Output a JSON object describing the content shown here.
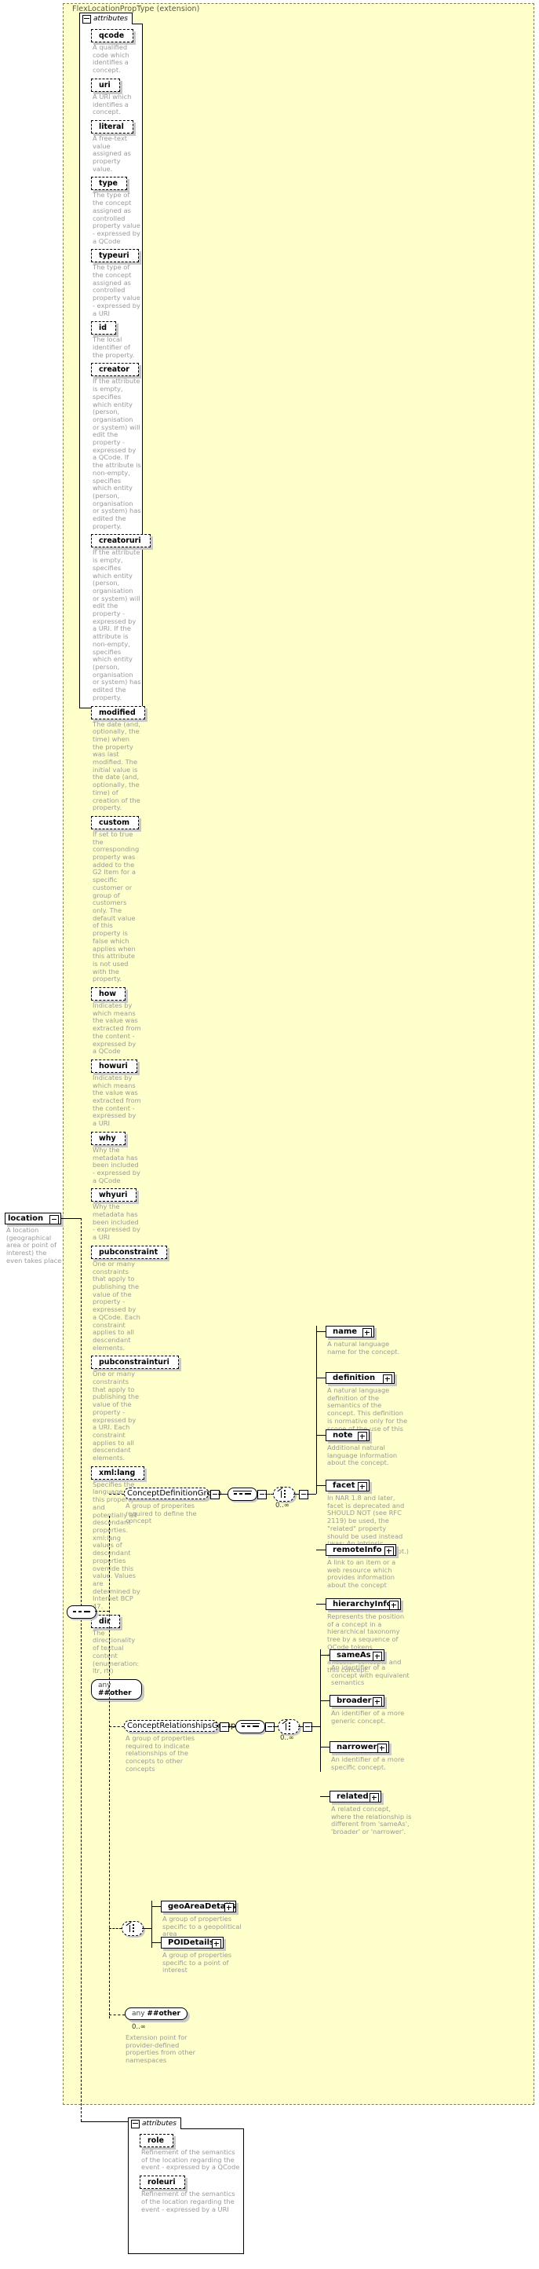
{
  "diagram": {
    "extension_title": "FlexLocationPropType (extension)",
    "attributes_label": "attributes",
    "any_other": {
      "prefix": "any",
      "name": "##other"
    }
  },
  "location_element": {
    "name": "location",
    "description": "A location (geographical area or point of interest) the even takes place"
  },
  "attributes": [
    {
      "name": "qcode",
      "description": "A qualified code which identifies a concept."
    },
    {
      "name": "uri",
      "description": "A URI which identifies a concept."
    },
    {
      "name": "literal",
      "description": "A free-text value assigned as property value."
    },
    {
      "name": "type",
      "description": "The type of the concept assigned as controlled property value - expressed by a QCode"
    },
    {
      "name": "typeuri",
      "description": "The type of the concept assigned as controlled property value - expressed by a URI"
    },
    {
      "name": "id",
      "description": "The local identifier of the property."
    },
    {
      "name": "creator",
      "description": "If the attribute is empty, specifies which entity (person, organisation or system) will edit the property - expressed by a QCode. If the attribute is non-empty, specifies which entity (person, organisation or system) has edited the property."
    },
    {
      "name": "creatoruri",
      "description": "If the attribute is empty, specifies which entity (person, organisation or system) will edit the property - expressed by a URI. If the attribute is non-empty, specifies which entity (person, organisation or system) has edited the property."
    },
    {
      "name": "modified",
      "description": "The date (and, optionally, the time) when the property was last modified. The initial value is the date (and, optionally, the time) of creation of the property."
    },
    {
      "name": "custom",
      "description": "If set to true the corresponding property was added to the G2 Item for a specific customer or group of customers only. The default value of this property is false which applies when this attribute is not used with the property."
    },
    {
      "name": "how",
      "description": "Indicates by which means the value was extracted from the content - expressed by a QCode"
    },
    {
      "name": "howuri",
      "description": "Indicates by which means the value was extracted from the content - expressed by a URI"
    },
    {
      "name": "why",
      "description": "Why the metadata has been included - expressed by a QCode"
    },
    {
      "name": "whyuri",
      "description": "Why the metadata has been included - expressed by a URI"
    },
    {
      "name": "pubconstraint",
      "description": "One or many constraints that apply to publishing the value of the property - expressed by a QCode. Each constraint applies to all descendant elements."
    },
    {
      "name": "pubconstrainturi",
      "description": "One or many constraints that apply to publishing the value of the property - expressed by a URI. Each constraint applies to all descendant elements."
    },
    {
      "name": "xml:lang",
      "description": "Specifies the language of this property and potentially all descendant properties. xml:lang values of descendant properties override this value. Values are determined by Internet BCP 47."
    },
    {
      "name": "dir",
      "description": "The directionality of textual content (enumeration: ltr, rtl)"
    }
  ],
  "groups": {
    "concept_definition": {
      "name": "ConceptDefinitionGroup",
      "description": "A group of properites required to define the concept",
      "cardinality": "0..∞",
      "elements": [
        {
          "name": "name",
          "description": "A natural language name for the concept."
        },
        {
          "name": "definition",
          "description": "A natural language definition of the semantics of the concept. This definition is normative only for the scope of the use of this concept."
        },
        {
          "name": "note",
          "description": "Additional natural language information about the concept."
        },
        {
          "name": "facet",
          "description": "In NAR 1.8 and later, facet is deprecated and SHOULD NOT (see RFC 2119) be used, the \"related\" property should be used instead (was: An intrinsic property of the concept.)"
        },
        {
          "name": "remoteInfo",
          "description": "A link to an item or a web resource which provides information about the concept"
        },
        {
          "name": "hierarchyInfo",
          "description": "Represents the position of a concept in a hierarchical taxonomy tree by a sequence of QCode tokens representing the ancestor concepts and this concept."
        }
      ]
    },
    "concept_relationships": {
      "name": "ConceptRelationshipsGroup",
      "description": "A group of properties required to indicate relationships of the concepts to other concepts",
      "cardinality": "0..∞",
      "elements": [
        {
          "name": "sameAs",
          "description": "An identifier of a concept with equivalent semantics"
        },
        {
          "name": "broader",
          "description": "An identifier of a more generic concept."
        },
        {
          "name": "narrower",
          "description": "An identifier of a more specific concept."
        },
        {
          "name": "related",
          "description": "A related concept, where the relationship is different from 'sameAs', 'broader' or 'narrower'."
        }
      ]
    },
    "details": [
      {
        "name": "geoAreaDetails",
        "description": "A group of properties specific to a geopolitical area"
      },
      {
        "name": "POIDetails",
        "description": "A group of properties specific to a point of interest"
      }
    ],
    "any_other": {
      "prefix": "any",
      "name": "##other",
      "cardinality": "0..∞",
      "description": "Extension point for provider-defined properties from other namespaces"
    }
  },
  "location_attributes": [
    {
      "name": "role",
      "description": "Refinement of the semantics of the location regarding the event - expressed by a QCode"
    },
    {
      "name": "roleuri",
      "description": "Refinement of the semantics of the location regarding the event - expressed by a URI"
    }
  ]
}
